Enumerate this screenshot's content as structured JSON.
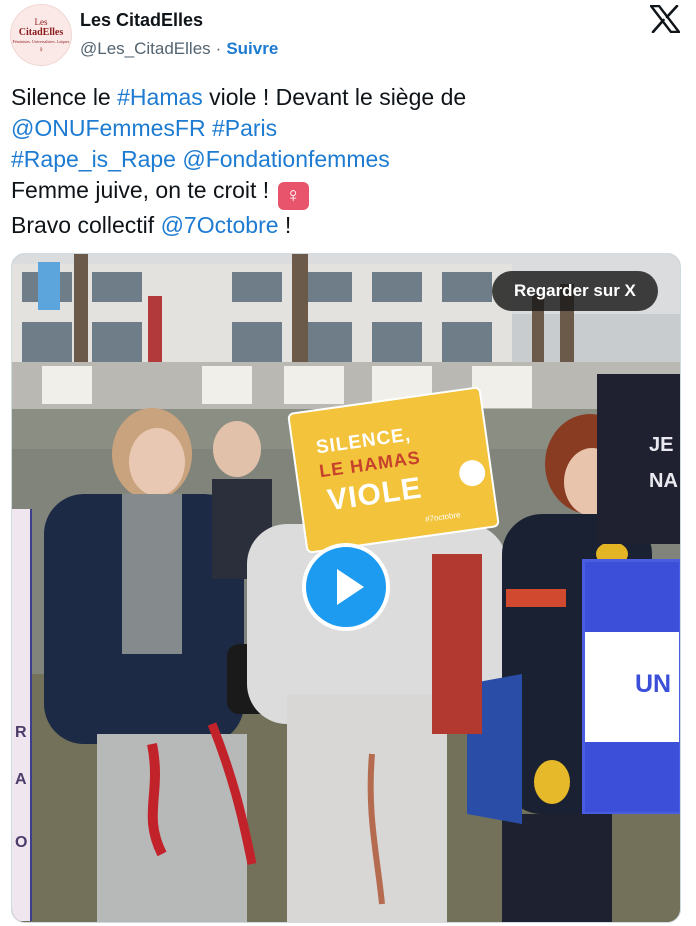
{
  "account": {
    "name": "Les CitadElles",
    "handle": "@Les_CitadElles",
    "separator": "·",
    "follow_label": "Suivre",
    "avatar": {
      "line1": "Les",
      "line2": "CitadElles",
      "line3": "Féministes. Universalistes. Laïques",
      "symbol": "♀"
    }
  },
  "platform_icon": "x-logo-icon",
  "tweet": {
    "line1": {
      "t1": "Silence le ",
      "l1": "#Hamas",
      "t2": " viole ! Devant le siège de"
    },
    "line2": {
      "l1": "@ONUFemmesFR",
      "t1": " ",
      "l2": "#Paris"
    },
    "line3": {
      "l1": "#Rape_is_Rape",
      "t1": " ",
      "l2": "@Fondationfemmes"
    },
    "line4": {
      "t1": "Femme juive, on te croit ! ",
      "emoji": "♀"
    },
    "line5": {
      "t1": "Bravo collectif ",
      "l1": "@7Octobre",
      "t2": " !"
    }
  },
  "media": {
    "watch_label": "Regarder sur X",
    "play_icon": "play-icon",
    "sign_yellow": {
      "line1": "SILENCE,",
      "line2": "LE HAMAS",
      "line3": "VIOLE",
      "tag": "#7octobre"
    },
    "sign_un": {
      "text": "UN"
    },
    "sign_dark": {
      "line1": "JE",
      "line2": "NA"
    },
    "sign_left": {
      "c1": "R",
      "c2": "A",
      "c3": "O"
    }
  },
  "colors": {
    "link": "#1d7bd1",
    "play": "#1d9bf0",
    "venus_bg": "#e8546c",
    "sign_yellow": "#f2c33b"
  }
}
